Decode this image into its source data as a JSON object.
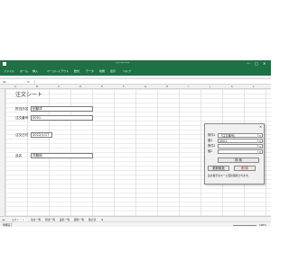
{
  "window": {
    "title": "*** *** ***",
    "min": "—",
    "max": "□",
    "close": "✕"
  },
  "menu": [
    "ファイル",
    "ホーム",
    "挿入",
    "ページレイアウト",
    "数式",
    "データ",
    "校閲",
    "表示",
    "ヘルプ"
  ],
  "formula_bar": {
    "name_box": "A1",
    "fx": "fx"
  },
  "columns": [
    "A",
    "B",
    "C",
    "D",
    "E",
    "F",
    "G",
    "H",
    "I",
    "J",
    "K",
    "L"
  ],
  "sheet": {
    "title": "注文シート",
    "fields": [
      {
        "label": "担当氏名",
        "value": "田藤洋"
      },
      {
        "label": "注文番号",
        "value": "0001"
      },
      {
        "label": "注文日付",
        "value": "2022/1/17"
      },
      {
        "label": "品名",
        "value": "洋服用"
      }
    ]
  },
  "dialog": {
    "close": "✕",
    "rows": [
      {
        "label": "条件1",
        "value": "「注文番号」"
      },
      {
        "label": "値1",
        "value": "0001"
      },
      {
        "label": "条件2",
        "value": ""
      },
      {
        "label": "値2",
        "value": ""
      }
    ],
    "search_button": "検 索",
    "update_button": "更新取扱",
    "delete_button": "削 除",
    "note": "注文番号をキーに更新取扱されます。"
  },
  "sheet_tabs": [
    "注文シート",
    "注文一覧",
    "担当一覧",
    "品名一覧",
    "顧客一覧",
    "集計表"
  ],
  "status": {
    "ready": "準備完了",
    "zoom": "100%"
  },
  "colors": {
    "excel_green": "#1e7145",
    "delete_red": "#c00000"
  }
}
